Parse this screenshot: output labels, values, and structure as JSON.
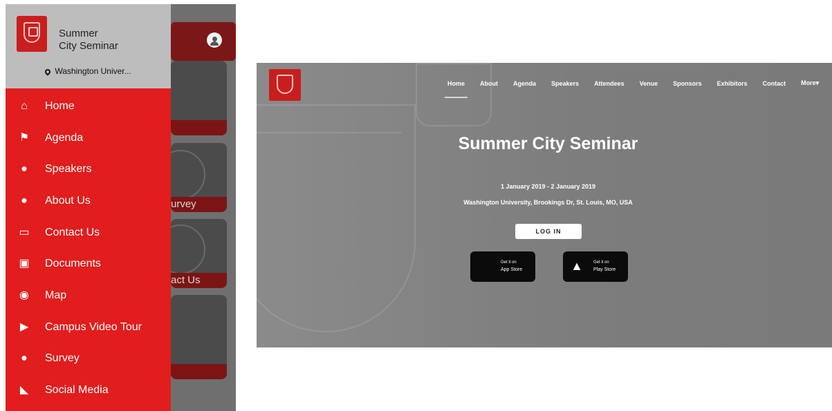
{
  "mobile": {
    "app_title_line1": "Summer",
    "app_title_line2": "City Seminar",
    "location": "Washington Univer...",
    "menu": [
      {
        "label": "Home",
        "icon": "home-icon"
      },
      {
        "label": "Agenda",
        "icon": "flag-icon"
      },
      {
        "label": "Speakers",
        "icon": "users-icon"
      },
      {
        "label": "About Us",
        "icon": "chat-icon"
      },
      {
        "label": "Contact Us",
        "icon": "inbox-icon"
      },
      {
        "label": "Documents",
        "icon": "pdf-icon"
      },
      {
        "label": "Map",
        "icon": "map-pin-icon"
      },
      {
        "label": "Campus Video Tour",
        "icon": "play-icon"
      },
      {
        "label": "Survey",
        "icon": "chat-icon"
      },
      {
        "label": "Social Media",
        "icon": "rss-icon"
      }
    ],
    "background_tiles": [
      "urvey",
      "act Us"
    ]
  },
  "desktop": {
    "nav": [
      "Home",
      "About",
      "Agenda",
      "Speakers",
      "Attendees",
      "Venue",
      "Sponsors",
      "Exhibitors",
      "Contact",
      "More"
    ],
    "nav_more_suffix": "▾",
    "title": "Summer City Seminar",
    "dates": "1 January 2019 - 2 January 2019",
    "address": "Washington University, Brookings Dr, St. Louis, MO, USA",
    "login_label": "LOG IN",
    "app_store": {
      "line1": "Get it on",
      "line2": "App Store"
    },
    "play_store": {
      "line1": "Get it on",
      "line2": "Play Store"
    }
  },
  "colors": {
    "brand_red": "#e11d1d",
    "dark_red": "#7c1717",
    "drawer_header": "#bdbdbd"
  }
}
